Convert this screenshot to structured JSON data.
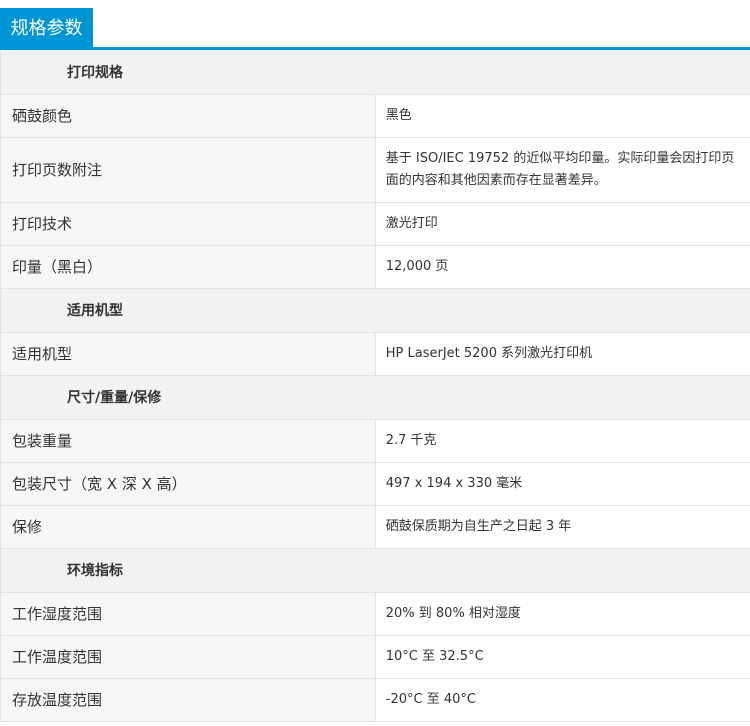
{
  "header": {
    "title": "规格参数"
  },
  "sections": [
    {
      "title": "打印规格",
      "rows": [
        {
          "label": "硒鼓颜色",
          "value": "黑色"
        },
        {
          "label": "打印页数附注",
          "value": "基于 ISO/IEC 19752 的近似平均印量。实际印量会因打印页面的内容和其他因素而存在显著差异。"
        },
        {
          "label": "打印技术",
          "value": "激光打印"
        },
        {
          "label": "印量（黑白）",
          "value": "12,000 页"
        }
      ]
    },
    {
      "title": "适用机型",
      "rows": [
        {
          "label": "适用机型",
          "value": "HP LaserJet 5200 系列激光打印机"
        }
      ]
    },
    {
      "title": "尺寸/重量/保修",
      "rows": [
        {
          "label": "包装重量",
          "value": "2.7 千克"
        },
        {
          "label": "包装尺寸（宽 X 深 X 高）",
          "value": "497 x 194 x 330 毫米"
        },
        {
          "label": "保修",
          "value": "硒鼓保质期为自生产之日起 3 年"
        }
      ]
    },
    {
      "title": "环境指标",
      "rows": [
        {
          "label": "工作湿度范围",
          "value": "20% 到 80% 相对湿度"
        },
        {
          "label": "工作温度范围",
          "value": "10°C 至 32.5°C"
        },
        {
          "label": "存放温度范围",
          "value": "-20°C 至 40°C"
        }
      ]
    }
  ]
}
